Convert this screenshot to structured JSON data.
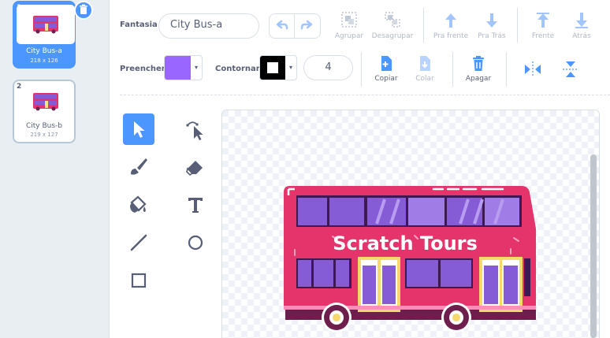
{
  "costumes": [
    {
      "number": "1",
      "name": "City Bus-a",
      "size": "218 x 126",
      "selected": true
    },
    {
      "number": "2",
      "name": "City Bus-b",
      "size": "219 x 127",
      "selected": false
    }
  ],
  "toolbar": {
    "costume_label": "Fantasia",
    "costume_name": "City Bus-a",
    "group": "Agrupar",
    "ungroup": "Desagrupar",
    "forward": "Pra frente",
    "backward": "Pra Trás",
    "front": "Frente",
    "back": "Atrás",
    "fill_label": "Preencher",
    "fill_color": "#9966ff",
    "outline_label": "Contornar",
    "outline_color": "#000000",
    "outline_width": "4",
    "copy": "Copiar",
    "paste": "Colar",
    "delete": "Apagar"
  },
  "canvas": {
    "bus_text": "Scratch Tours"
  },
  "colors": {
    "accent": "#4c97ff",
    "bus_body": "#e5336c",
    "bus_windows": "#855cd6"
  }
}
